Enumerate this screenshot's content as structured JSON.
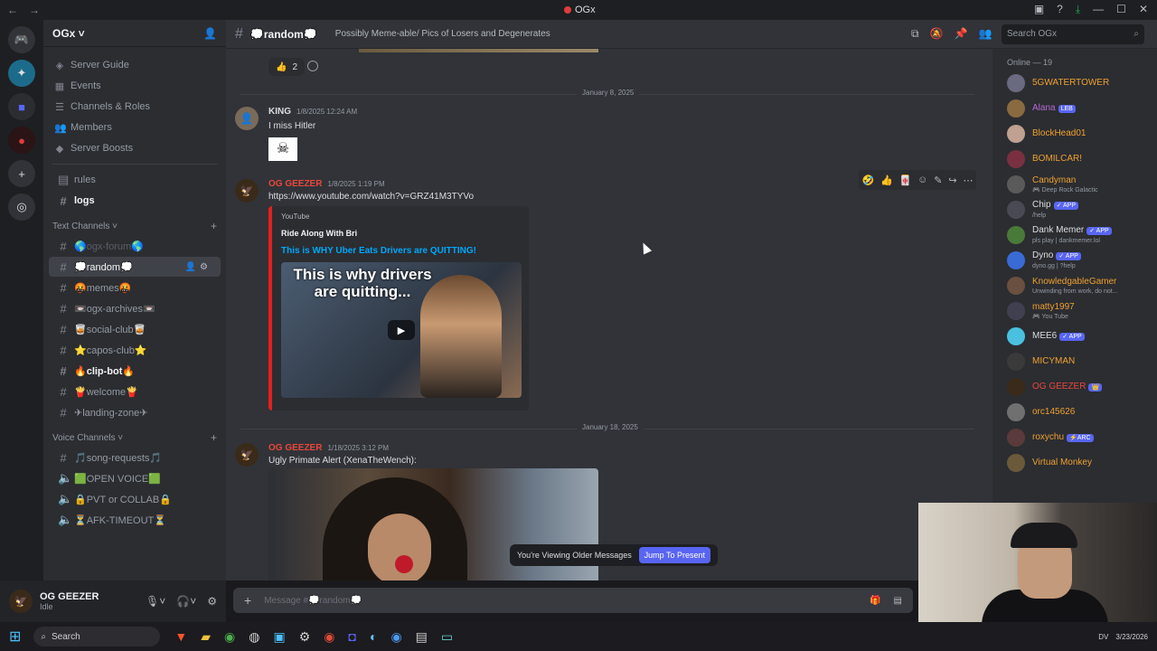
{
  "window": {
    "title": "OGx"
  },
  "server": {
    "name": "OGx ˅"
  },
  "nav": [
    {
      "label": "Server Guide",
      "icon": "compass-icon"
    },
    {
      "label": "Events",
      "icon": "calendar-icon"
    },
    {
      "label": "Channels & Roles",
      "icon": "list-icon"
    },
    {
      "label": "Members",
      "icon": "members-icon"
    },
    {
      "label": "Server Boosts",
      "icon": "boost-icon"
    }
  ],
  "top_channels": [
    {
      "label": "rules",
      "bold": false
    },
    {
      "label": "logs",
      "bold": true
    }
  ],
  "text_category": "Text Channels ˅",
  "text_channels": [
    {
      "label": "🌎ogx-forum🌎",
      "state": "muted"
    },
    {
      "label": "💭random💭",
      "state": "active"
    },
    {
      "label": "🤬memes🤬",
      "state": ""
    },
    {
      "label": "📼ogx-archives📼",
      "state": ""
    },
    {
      "label": "🥃social-club🥃",
      "state": ""
    },
    {
      "label": "⭐capos-club⭐",
      "state": ""
    },
    {
      "label": "🔥clip-bot🔥",
      "state": "bold"
    },
    {
      "label": "🍟welcome🍟",
      "state": ""
    },
    {
      "label": "✈landing-zone✈",
      "state": ""
    }
  ],
  "voice_category": "Voice Channels ˅",
  "voice_channels": [
    {
      "label": "🎵song-requests🎵"
    },
    {
      "label": "🟩OPEN VOICE🟩"
    },
    {
      "label": "🔒PVT or COLLAB🔒"
    },
    {
      "label": "⏳AFK-TIMEOUT⏳"
    }
  ],
  "user": {
    "name": "OG GEEZER",
    "status": "Idle"
  },
  "channel": {
    "name": "💭random💭",
    "topic": "Possibly Meme-able/ Pics of Losers and Degenerates"
  },
  "search": {
    "placeholder": "Search OGx"
  },
  "reaction": {
    "emoji": "👍",
    "count": "2"
  },
  "date1": "January 8, 2025",
  "msg1": {
    "author": "KING",
    "time": "1/8/2025 12:24 AM",
    "text": "I miss Hitler",
    "color": "#dbdee1"
  },
  "msg2": {
    "author": "OG GEEZER",
    "time": "1/8/2025 1:19 PM",
    "link": "https://www.youtube.com/watch?v=GRZ41M3TYVo",
    "color": "#e8473c"
  },
  "embed": {
    "provider": "YouTube",
    "author": "Ride Along With Bri",
    "title": "This is WHY Uber Eats Drivers are QUITTING!",
    "thumb_caption": "This is why drivers are quitting..."
  },
  "date2": "January 18, 2025",
  "msg3": {
    "author": "OG GEEZER",
    "time": "1/18/2025 3:12 PM",
    "text": "Ugly Primate Alert (XenaTheWench):",
    "color": "#e8473c"
  },
  "older_bar": {
    "text": "You're Viewing Older Messages",
    "button": "Jump To Present"
  },
  "input": {
    "placeholder": "Message #💭random💭"
  },
  "members_header": "Online — 19",
  "members": [
    {
      "name": "5GWATERTOWER",
      "color": "#f0a030",
      "activity": "",
      "badge": "",
      "av": "#6a6a80"
    },
    {
      "name": "Alana",
      "color": "#b56bd6",
      "activity": "",
      "badge": "LEB",
      "av": "#8a6a40"
    },
    {
      "name": "BlockHead01",
      "color": "#f0a030",
      "activity": "",
      "badge": "",
      "av": "#c0a090"
    },
    {
      "name": "BOMILCAR!",
      "color": "#f0a030",
      "activity": "",
      "badge": "",
      "av": "#7a3040"
    },
    {
      "name": "Candyman",
      "color": "#f0a030",
      "activity": "🎮 Deep Rock Galactic",
      "badge": "",
      "av": "#5a5a5a"
    },
    {
      "name": "Chip",
      "color": "#dbdee1",
      "activity": "/help",
      "badge": "✓ APP",
      "av": "#4a4a55"
    },
    {
      "name": "Dank Memer",
      "color": "#dbdee1",
      "activity": "pls play | dankmemer.lol",
      "badge": "✓ APP",
      "av": "#4a7a3a"
    },
    {
      "name": "Dyno",
      "color": "#dbdee1",
      "activity": "dyno.gg | ?help",
      "badge": "✓ APP",
      "av": "#3a6ad6"
    },
    {
      "name": "KnowledgableGamer",
      "color": "#f0a030",
      "activity": "Unwinding from work, do not...",
      "badge": "",
      "av": "#6a5040"
    },
    {
      "name": "matty1997",
      "color": "#f0a030",
      "activity": "🎮 You Tube",
      "badge": "",
      "av": "#404050"
    },
    {
      "name": "MEE6",
      "color": "#dbdee1",
      "activity": "",
      "badge": "✓ APP",
      "av": "#4ac0e0"
    },
    {
      "name": "MICYMAN",
      "color": "#f0a030",
      "activity": "",
      "badge": "",
      "av": "#3a3a3a"
    },
    {
      "name": "OG GEEZER",
      "color": "#e8473c",
      "activity": "",
      "badge": "👑",
      "av": "#3a2a1a"
    },
    {
      "name": "orc145626",
      "color": "#f0a030",
      "activity": "",
      "badge": "",
      "av": "#707070"
    },
    {
      "name": "roxychu",
      "color": "#f0a030",
      "activity": "",
      "badge": "⚡ARC",
      "av": "#5a3a3a"
    },
    {
      "name": "Virtual Monkey",
      "color": "#f0a030",
      "activity": "",
      "badge": "",
      "av": "#6a5a3a"
    }
  ],
  "taskbar": {
    "search": "Search",
    "tray_text": "DV",
    "date": "3/23/2026"
  }
}
